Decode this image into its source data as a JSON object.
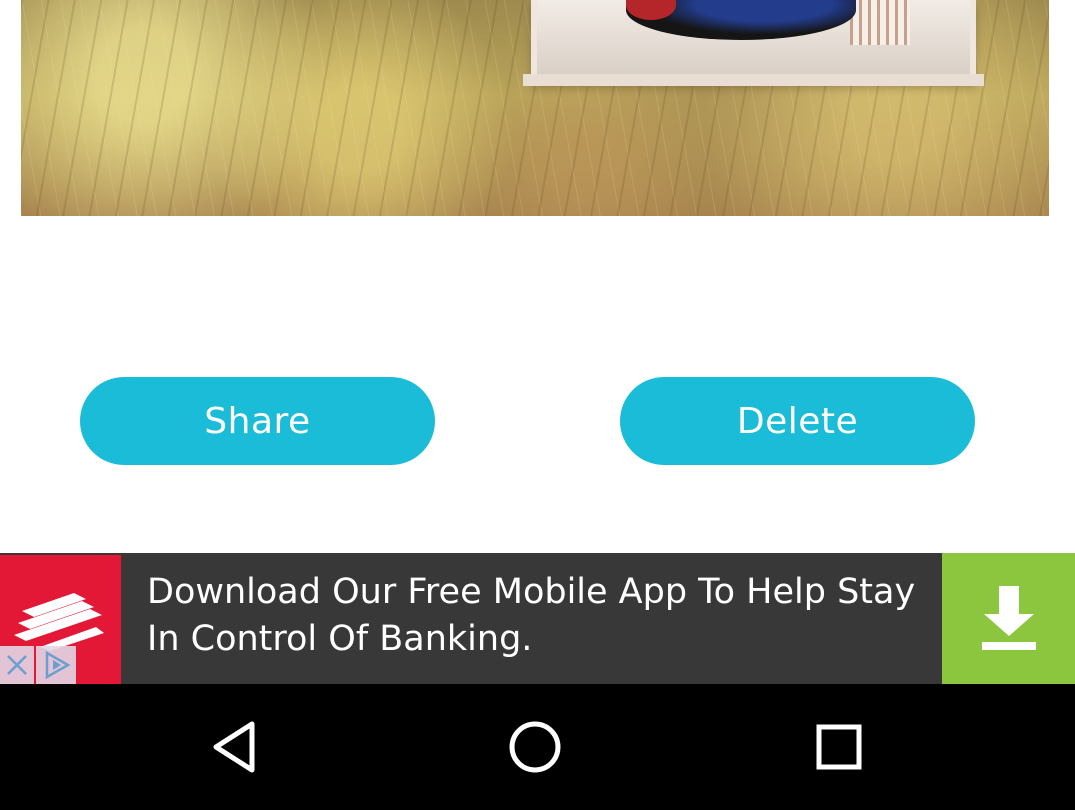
{
  "buttons": {
    "share_label": "Share",
    "delete_label": "Delete"
  },
  "ad": {
    "text": "Download Our Free Mobile App To Help Stay In Control Of Banking.",
    "logo_icon": "bank-flag-logo-icon",
    "download_icon": "download-arrow-icon",
    "close_icon": "close-icon",
    "adchoices_icon": "adchoices-icon",
    "colors": {
      "background": "#383838",
      "logo": "#e31837",
      "download": "#8cc63f"
    }
  },
  "navbar": {
    "back_icon": "back-triangle-icon",
    "home_icon": "home-circle-icon",
    "recents_icon": "recents-square-icon"
  },
  "colors": {
    "accent": "#1bbcd7"
  }
}
